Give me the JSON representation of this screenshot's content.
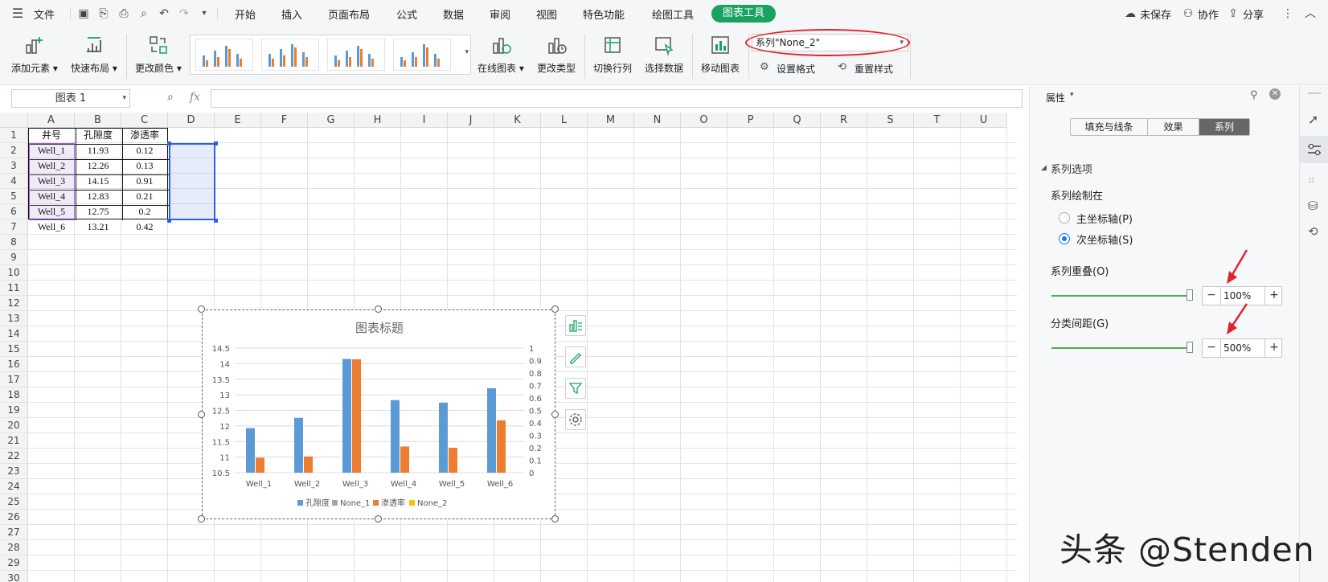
{
  "menu": {
    "file": "文件",
    "tabs": [
      "开始",
      "插入",
      "页面布局",
      "公式",
      "数据",
      "审阅",
      "视图",
      "特色功能",
      "绘图工具"
    ],
    "active_tab": "图表工具",
    "unsaved": "未保存",
    "collab": "协作",
    "share": "分享"
  },
  "ribbon": {
    "add_element": "添加元素",
    "quick_layout": "快速布局",
    "change_color": "更改颜色",
    "online_chart": "在线图表",
    "change_type": "更改类型",
    "switch_rowcol": "切换行列",
    "select_data": "选择数据",
    "move_chart": "移动图表",
    "series_select": "系列\"None_2\"",
    "set_format": "设置格式",
    "reset_style": "重置样式"
  },
  "formula": {
    "name_box": "图表 1",
    "fx": "fx",
    "value": ""
  },
  "columns": [
    "A",
    "B",
    "C",
    "D",
    "E",
    "F",
    "G",
    "H",
    "I",
    "J",
    "K",
    "L",
    "M",
    "N",
    "O",
    "P",
    "Q",
    "R",
    "S",
    "T",
    "U"
  ],
  "rows": [
    "1",
    "2",
    "3",
    "4",
    "5",
    "6",
    "7",
    "8",
    "9",
    "10",
    "11",
    "12",
    "13",
    "14",
    "15",
    "16",
    "17",
    "18",
    "19",
    "20",
    "21",
    "22",
    "23",
    "24",
    "25",
    "26",
    "27",
    "28",
    "29",
    "30"
  ],
  "table": {
    "headers": [
      "井号",
      "孔隙度",
      "渗透率"
    ],
    "rows": [
      [
        "Well_1",
        "11.93",
        "0.12"
      ],
      [
        "Well_2",
        "12.26",
        "0.13"
      ],
      [
        "Well_3",
        "14.15",
        "0.91"
      ],
      [
        "Well_4",
        "12.83",
        "0.21"
      ],
      [
        "Well_5",
        "12.75",
        "0.2"
      ],
      [
        "Well_6",
        "13.21",
        "0.42"
      ]
    ]
  },
  "chart_data": {
    "type": "bar",
    "title": "图表标题",
    "categories": [
      "Well_1",
      "Well_2",
      "Well_3",
      "Well_4",
      "Well_5",
      "Well_6"
    ],
    "series": [
      {
        "name": "孔隙度",
        "values": [
          11.93,
          12.26,
          14.15,
          12.83,
          12.75,
          13.21
        ],
        "axis": "primary",
        "color": "#5b9bd5"
      },
      {
        "name": "None_1",
        "values": [],
        "axis": "primary",
        "color": "#a5a5a5"
      },
      {
        "name": "渗透率",
        "values": [
          0.12,
          0.13,
          0.91,
          0.21,
          0.2,
          0.42
        ],
        "axis": "secondary",
        "color": "#ed7d31"
      },
      {
        "name": "None_2",
        "values": [],
        "axis": "secondary",
        "color": "#ffc000"
      }
    ],
    "ylim": [
      10.5,
      14.5
    ],
    "y_ticks": [
      "10.5",
      "11",
      "11.5",
      "12",
      "12.5",
      "13",
      "13.5",
      "14",
      "14.5"
    ],
    "y2lim": [
      0,
      1
    ],
    "y2_ticks": [
      "0",
      "0.1",
      "0.2",
      "0.3",
      "0.4",
      "0.5",
      "0.6",
      "0.7",
      "0.8",
      "0.9",
      "1"
    ],
    "legend": "bottom",
    "grid": true
  },
  "pane": {
    "title": "属性",
    "tabs": [
      "填充与线条",
      "效果",
      "系列"
    ],
    "active_tab": "系列",
    "section": "系列选项",
    "plot_on": "系列绘制在",
    "primary_axis": "主坐标轴(P)",
    "secondary_axis": "次坐标轴(S)",
    "overlap_label": "系列重叠(O)",
    "overlap_value": "100%",
    "overlap_level": 1.0,
    "gap_label": "分类间距(G)",
    "gap_value": "500%",
    "gap_level": 1.0
  },
  "watermark": "头条 @Stenden",
  "colors": {
    "accent": "#1aa260",
    "annotation": "#e0242c",
    "selection": "#2f5fe8"
  }
}
